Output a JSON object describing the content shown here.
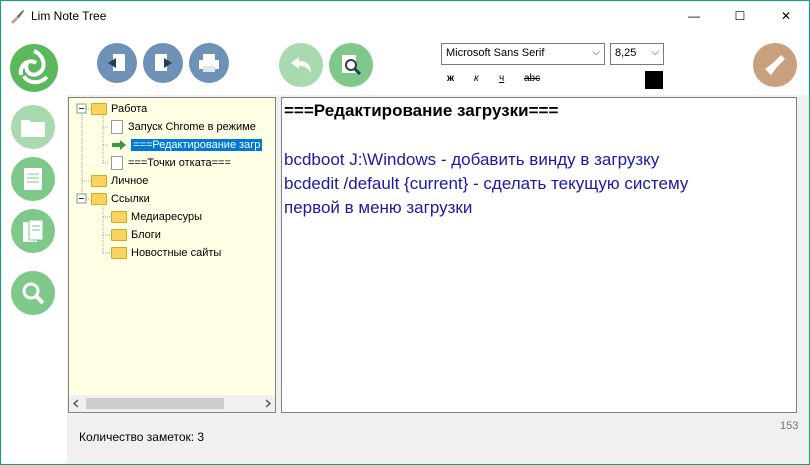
{
  "window": {
    "title": "Lim Note Tree",
    "minimize": "—",
    "maximize": "☐",
    "close": "✕"
  },
  "toolbar": {
    "font_name": "Microsoft Sans Serif",
    "font_size": "8,25",
    "bold": "ж",
    "italic": "к",
    "underline": "ч",
    "strike": "abc",
    "text_color": "#000000"
  },
  "tree": {
    "nodes": [
      {
        "label": "Работа",
        "type": "folder"
      },
      {
        "label": "Запуск Chrome в режиме",
        "type": "note"
      },
      {
        "label": "===Редактирование загр",
        "type": "note-selected"
      },
      {
        "label": "===Точки отката===",
        "type": "note"
      },
      {
        "label": "Личное",
        "type": "folder"
      },
      {
        "label": "Ссылки",
        "type": "folder"
      },
      {
        "label": "Медиаресуры",
        "type": "folder"
      },
      {
        "label": "Блоги",
        "type": "folder"
      },
      {
        "label": "Новостные сайты",
        "type": "folder"
      }
    ]
  },
  "editor": {
    "lines": [
      "===Редактирование загрузки===",
      "bcdboot J:\\Windows - добавить винду в загрузку",
      "bcdedit /default {current} - сделать текущую систему",
      "первой в меню загрузки"
    ]
  },
  "status": {
    "note_count": "Количество заметок: 3",
    "char_count": "153"
  },
  "colors": {
    "accent_green": "#7ec98a",
    "button_blue": "#6e91b8",
    "editor_blue": "#1a1aa6",
    "selection": "#0078d7"
  }
}
